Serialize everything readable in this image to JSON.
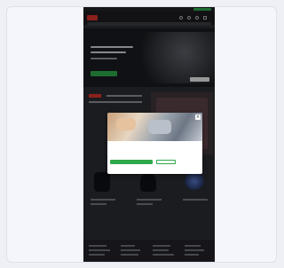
{
  "modal": {
    "close_icon": "×",
    "title": "",
    "body": "",
    "accept_label": "",
    "settings_label": ""
  },
  "colors": {
    "accent": "#2ea84a",
    "brand": "#d8322b",
    "page_background": "#2a2c31"
  },
  "icons": [
    "logo-icon",
    "search-icon",
    "user-icon",
    "cart-icon",
    "menu-icon",
    "close-icon"
  ]
}
